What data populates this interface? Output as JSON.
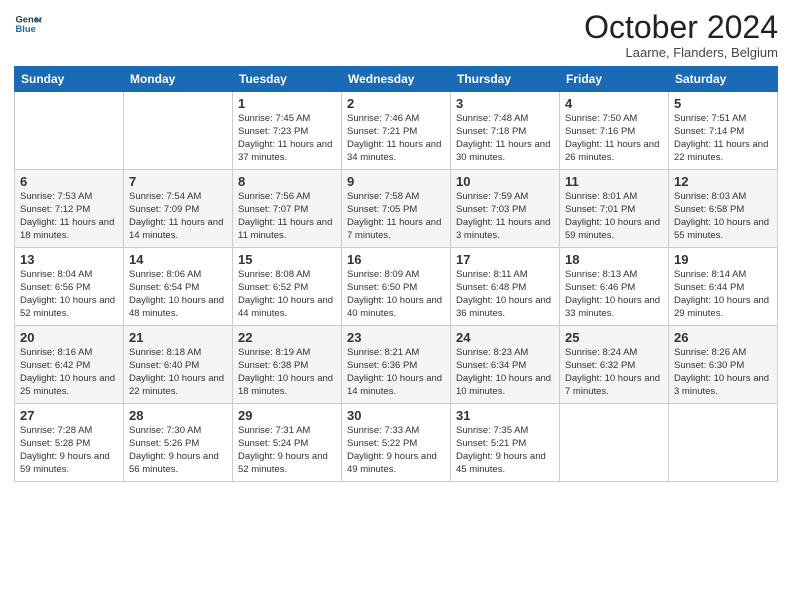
{
  "header": {
    "logo_line1": "General",
    "logo_line2": "Blue",
    "month": "October 2024",
    "location": "Laarne, Flanders, Belgium"
  },
  "weekdays": [
    "Sunday",
    "Monday",
    "Tuesday",
    "Wednesday",
    "Thursday",
    "Friday",
    "Saturday"
  ],
  "weeks": [
    [
      {
        "day": "",
        "text": ""
      },
      {
        "day": "",
        "text": ""
      },
      {
        "day": "1",
        "text": "Sunrise: 7:45 AM\nSunset: 7:23 PM\nDaylight: 11 hours\nand 37 minutes."
      },
      {
        "day": "2",
        "text": "Sunrise: 7:46 AM\nSunset: 7:21 PM\nDaylight: 11 hours\nand 34 minutes."
      },
      {
        "day": "3",
        "text": "Sunrise: 7:48 AM\nSunset: 7:18 PM\nDaylight: 11 hours\nand 30 minutes."
      },
      {
        "day": "4",
        "text": "Sunrise: 7:50 AM\nSunset: 7:16 PM\nDaylight: 11 hours\nand 26 minutes."
      },
      {
        "day": "5",
        "text": "Sunrise: 7:51 AM\nSunset: 7:14 PM\nDaylight: 11 hours\nand 22 minutes."
      }
    ],
    [
      {
        "day": "6",
        "text": "Sunrise: 7:53 AM\nSunset: 7:12 PM\nDaylight: 11 hours\nand 18 minutes."
      },
      {
        "day": "7",
        "text": "Sunrise: 7:54 AM\nSunset: 7:09 PM\nDaylight: 11 hours\nand 14 minutes."
      },
      {
        "day": "8",
        "text": "Sunrise: 7:56 AM\nSunset: 7:07 PM\nDaylight: 11 hours\nand 11 minutes."
      },
      {
        "day": "9",
        "text": "Sunrise: 7:58 AM\nSunset: 7:05 PM\nDaylight: 11 hours\nand 7 minutes."
      },
      {
        "day": "10",
        "text": "Sunrise: 7:59 AM\nSunset: 7:03 PM\nDaylight: 11 hours\nand 3 minutes."
      },
      {
        "day": "11",
        "text": "Sunrise: 8:01 AM\nSunset: 7:01 PM\nDaylight: 10 hours\nand 59 minutes."
      },
      {
        "day": "12",
        "text": "Sunrise: 8:03 AM\nSunset: 6:58 PM\nDaylight: 10 hours\nand 55 minutes."
      }
    ],
    [
      {
        "day": "13",
        "text": "Sunrise: 8:04 AM\nSunset: 6:56 PM\nDaylight: 10 hours\nand 52 minutes."
      },
      {
        "day": "14",
        "text": "Sunrise: 8:06 AM\nSunset: 6:54 PM\nDaylight: 10 hours\nand 48 minutes."
      },
      {
        "day": "15",
        "text": "Sunrise: 8:08 AM\nSunset: 6:52 PM\nDaylight: 10 hours\nand 44 minutes."
      },
      {
        "day": "16",
        "text": "Sunrise: 8:09 AM\nSunset: 6:50 PM\nDaylight: 10 hours\nand 40 minutes."
      },
      {
        "day": "17",
        "text": "Sunrise: 8:11 AM\nSunset: 6:48 PM\nDaylight: 10 hours\nand 36 minutes."
      },
      {
        "day": "18",
        "text": "Sunrise: 8:13 AM\nSunset: 6:46 PM\nDaylight: 10 hours\nand 33 minutes."
      },
      {
        "day": "19",
        "text": "Sunrise: 8:14 AM\nSunset: 6:44 PM\nDaylight: 10 hours\nand 29 minutes."
      }
    ],
    [
      {
        "day": "20",
        "text": "Sunrise: 8:16 AM\nSunset: 6:42 PM\nDaylight: 10 hours\nand 25 minutes."
      },
      {
        "day": "21",
        "text": "Sunrise: 8:18 AM\nSunset: 6:40 PM\nDaylight: 10 hours\nand 22 minutes."
      },
      {
        "day": "22",
        "text": "Sunrise: 8:19 AM\nSunset: 6:38 PM\nDaylight: 10 hours\nand 18 minutes."
      },
      {
        "day": "23",
        "text": "Sunrise: 8:21 AM\nSunset: 6:36 PM\nDaylight: 10 hours\nand 14 minutes."
      },
      {
        "day": "24",
        "text": "Sunrise: 8:23 AM\nSunset: 6:34 PM\nDaylight: 10 hours\nand 10 minutes."
      },
      {
        "day": "25",
        "text": "Sunrise: 8:24 AM\nSunset: 6:32 PM\nDaylight: 10 hours\nand 7 minutes."
      },
      {
        "day": "26",
        "text": "Sunrise: 8:26 AM\nSunset: 6:30 PM\nDaylight: 10 hours\nand 3 minutes."
      }
    ],
    [
      {
        "day": "27",
        "text": "Sunrise: 7:28 AM\nSunset: 5:28 PM\nDaylight: 9 hours\nand 59 minutes."
      },
      {
        "day": "28",
        "text": "Sunrise: 7:30 AM\nSunset: 5:26 PM\nDaylight: 9 hours\nand 56 minutes."
      },
      {
        "day": "29",
        "text": "Sunrise: 7:31 AM\nSunset: 5:24 PM\nDaylight: 9 hours\nand 52 minutes."
      },
      {
        "day": "30",
        "text": "Sunrise: 7:33 AM\nSunset: 5:22 PM\nDaylight: 9 hours\nand 49 minutes."
      },
      {
        "day": "31",
        "text": "Sunrise: 7:35 AM\nSunset: 5:21 PM\nDaylight: 9 hours\nand 45 minutes."
      },
      {
        "day": "",
        "text": ""
      },
      {
        "day": "",
        "text": ""
      }
    ]
  ]
}
